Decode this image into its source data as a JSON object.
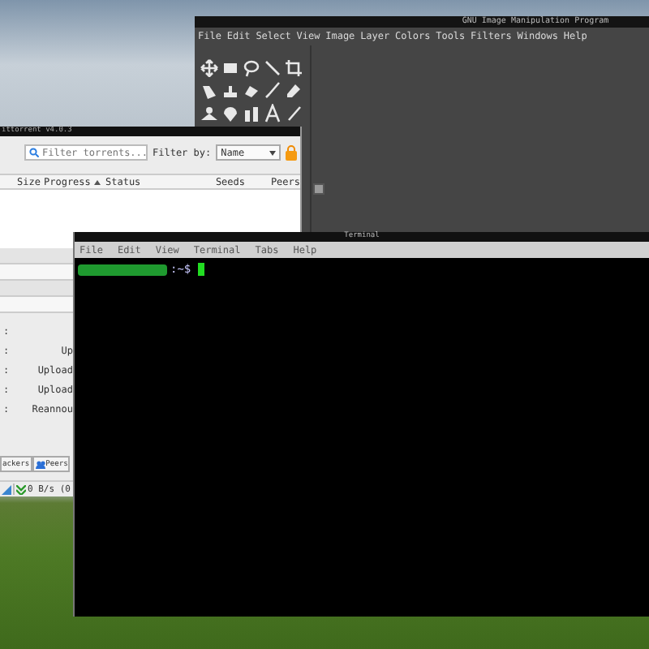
{
  "gimp": {
    "title": "GNU Image Manipulation Program",
    "menu": [
      "File",
      "Edit",
      "Select",
      "View",
      "Image",
      "Layer",
      "Colors",
      "Tools",
      "Filters",
      "Windows",
      "Help"
    ]
  },
  "torrent": {
    "title": "ittorrent v4.0.3",
    "search": {
      "placeholder": "Filter torrents..."
    },
    "filter_label": "Filter by:",
    "filter_value": "Name",
    "columns": [
      "Size",
      "Progress",
      "Status",
      "Seeds",
      "Peers"
    ],
    "properties": [
      {
        "label": ":"
      },
      {
        "label": ":",
        "value": "Up"
      },
      {
        "label": ":",
        "value": "Upload"
      },
      {
        "label": ":",
        "value": "Upload"
      },
      {
        "label": ":",
        "value": "Reannou"
      }
    ],
    "tabs": [
      "ackers",
      "Peers"
    ],
    "status": "0 B/s (0"
  },
  "terminal": {
    "title": "Terminal",
    "menu": [
      "File",
      "Edit",
      "View",
      "Terminal",
      "Tabs",
      "Help"
    ],
    "prompt": ":~$"
  }
}
